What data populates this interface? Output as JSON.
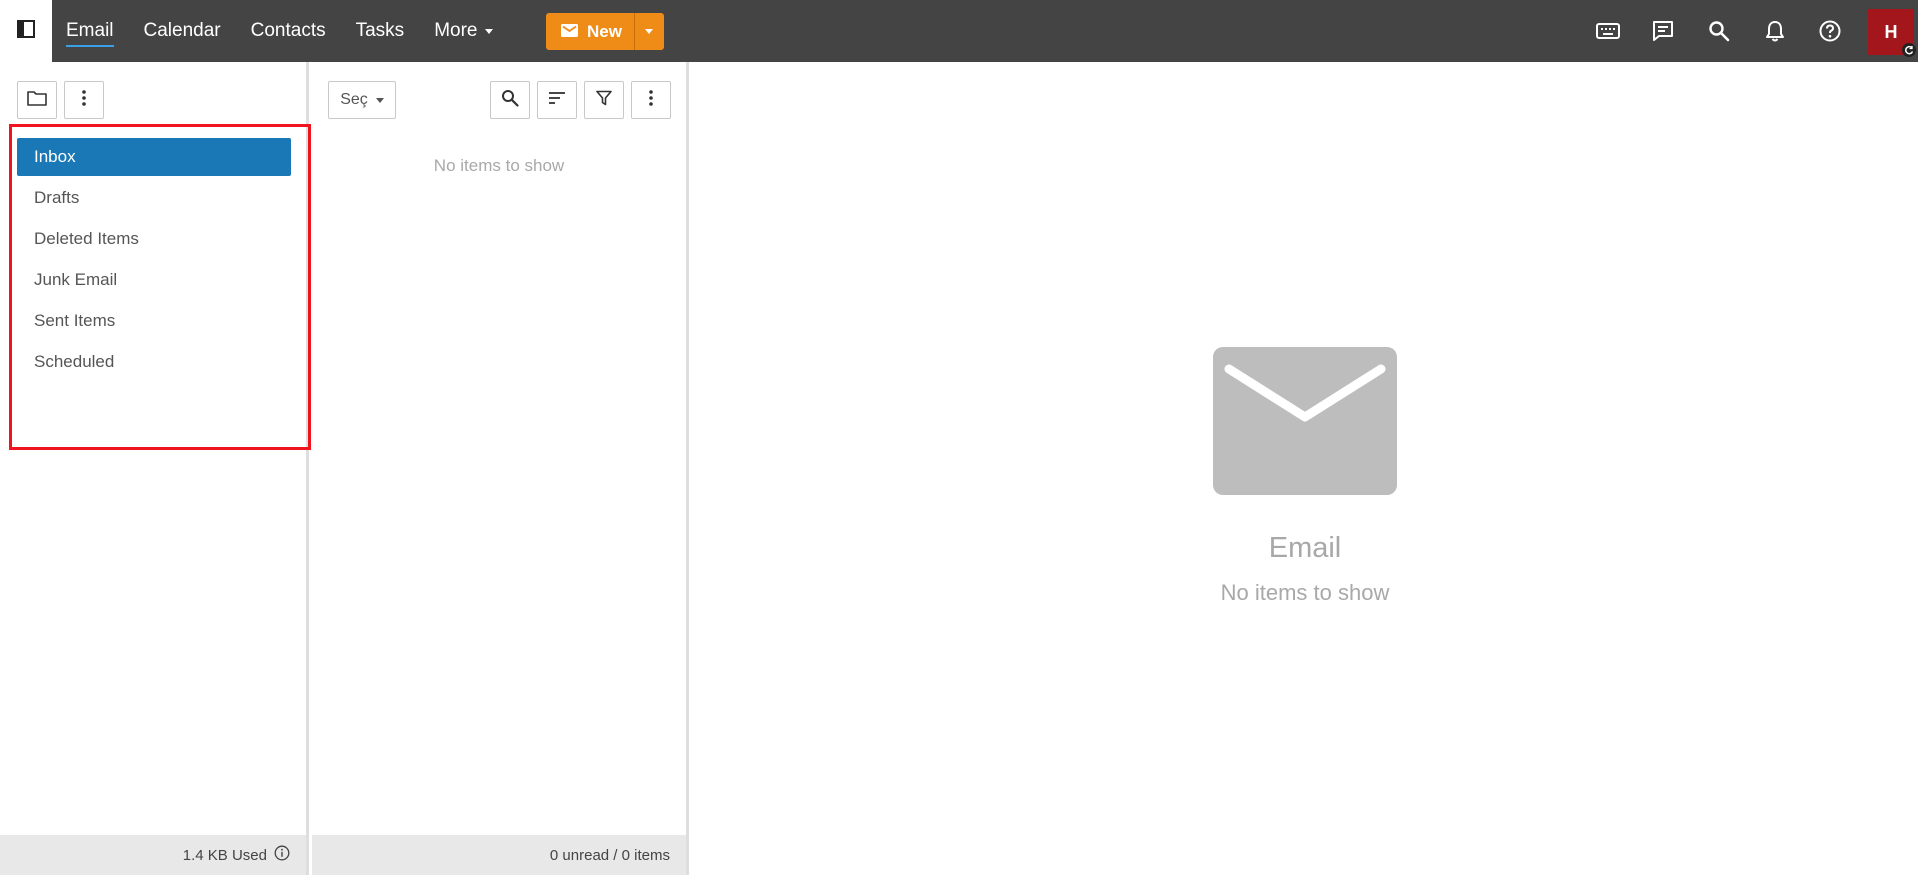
{
  "topbar": {
    "nav": [
      {
        "label": "Email",
        "active": true
      },
      {
        "label": "Calendar",
        "active": false
      },
      {
        "label": "Contacts",
        "active": false
      },
      {
        "label": "Tasks",
        "active": false
      }
    ],
    "more_label": "More",
    "new_label": "New",
    "avatar_initial": "H",
    "icons": [
      "keyboard-icon",
      "chat-icon",
      "search-icon",
      "bell-icon",
      "help-icon"
    ]
  },
  "folder_pane": {
    "folders": [
      {
        "label": "Inbox",
        "active": true
      },
      {
        "label": "Drafts",
        "active": false
      },
      {
        "label": "Deleted Items",
        "active": false
      },
      {
        "label": "Junk Email",
        "active": false
      },
      {
        "label": "Sent Items",
        "active": false
      },
      {
        "label": "Scheduled",
        "active": false
      }
    ],
    "storage_used": "1.4 KB Used"
  },
  "message_list": {
    "select_label": "Seç",
    "empty_text": "No items to show",
    "status": "0 unread / 0 items"
  },
  "reading_pane": {
    "title": "Email",
    "subtitle": "No items to show"
  },
  "colors": {
    "topbar": "#444444",
    "accent_orange": "#ef8c17",
    "selected_folder": "#1978b5",
    "avatar": "#a3161c",
    "annotation_red": "#f0141e"
  }
}
